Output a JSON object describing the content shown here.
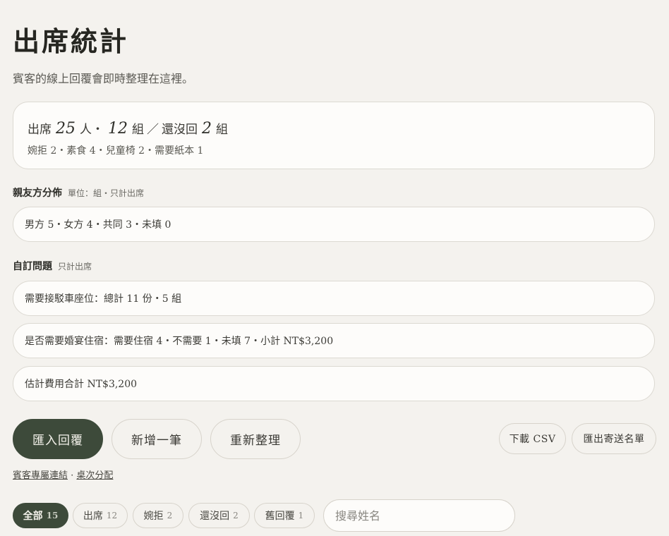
{
  "page": {
    "title": "出席統計",
    "subtitle": "賓客的線上回覆會即時整理在這裡。"
  },
  "summary": {
    "attend_label": "出席",
    "attend_people": "25",
    "people_unit": "人・",
    "attend_groups": "12",
    "groups_unit": "組",
    "slash": "／",
    "pending_label": "還沒回",
    "pending_groups": "2",
    "pending_unit": "組",
    "detail": "婉拒 2・素食 4・兒童椅 2・需要紙本 1"
  },
  "side": {
    "title": "親友方分佈",
    "note": "單位：組・只計出席",
    "content": "男方 5・女方 4・共同 3・未填 0"
  },
  "custom": {
    "title": "自訂問題",
    "note": "只計出席",
    "rows": [
      "需要接駁車座位：總計 11 份・5 組",
      "是否需要婚宴住宿：需要住宿 4・不需要 1・未填 7・小計 NT$3,200",
      "估計費用合計 NT$3,200"
    ]
  },
  "actions": {
    "import": "匯入回覆",
    "add": "新增一筆",
    "reorganize": "重新整理",
    "download_csv": "下載 CSV",
    "export_list": "匯出寄送名單"
  },
  "links": {
    "guest_links": "賓客專屬連結",
    "separator": " · ",
    "seating": "桌次分配"
  },
  "filters": [
    {
      "label": "全部",
      "count": "15",
      "active": true
    },
    {
      "label": "出席",
      "count": "12",
      "active": false
    },
    {
      "label": "婉拒",
      "count": "2",
      "active": false
    },
    {
      "label": "還沒回",
      "count": "2",
      "active": false
    },
    {
      "label": "舊回覆",
      "count": "1",
      "active": false
    }
  ],
  "search": {
    "placeholder": "搜尋姓名",
    "value": ""
  },
  "colors": {
    "accent": "#3d4a3a",
    "background": "#f4f2ee",
    "card": "#fdfcfa"
  }
}
